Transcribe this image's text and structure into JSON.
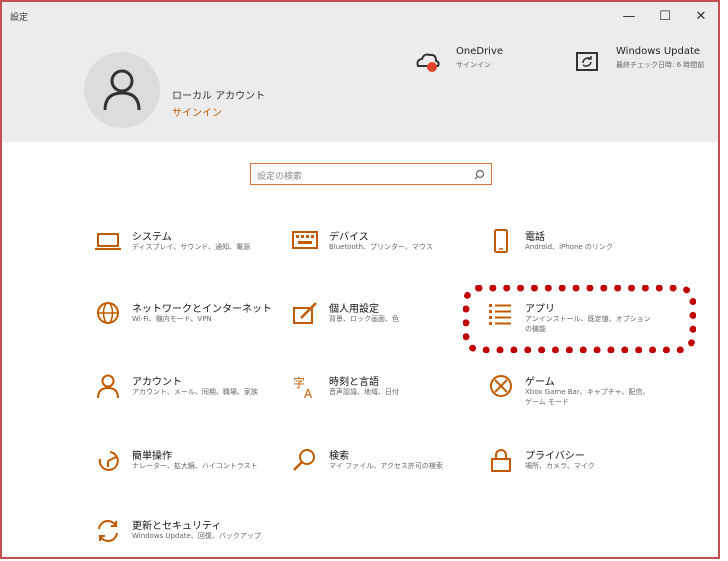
{
  "window": {
    "title": "設定",
    "minimize_glyph": "—",
    "maximize_glyph": "☐",
    "close_glyph": "✕"
  },
  "account": {
    "name": "ローカル アカウント",
    "signin": "サインイン"
  },
  "services": [
    {
      "title": "OneDrive",
      "sub": "サインイン",
      "icon": "cloud-icon"
    },
    {
      "title": "Windows Update",
      "sub": "最終チェック日時: 6 時間前",
      "icon": "update-icon"
    }
  ],
  "search": {
    "placeholder": "設定の検索"
  },
  "tiles": [
    {
      "title": "システム",
      "sub": "ディスプレイ、サウンド、通知、電源",
      "icon": "laptop-icon"
    },
    {
      "title": "デバイス",
      "sub": "Bluetooth、プリンター、マウス",
      "icon": "keyboard-icon"
    },
    {
      "title": "電話",
      "sub": "Android、iPhone のリンク",
      "icon": "phone-icon"
    },
    {
      "title": "ネットワークとインターネット",
      "sub": "Wi-Fi、機内モード、VPN",
      "icon": "globe-icon"
    },
    {
      "title": "個人用設定",
      "sub": "背景、ロック画面、色",
      "icon": "paint-icon"
    },
    {
      "title": "アプリ",
      "sub": "アンインストール、既定値、オプションの機能",
      "icon": "apps-list-icon"
    },
    {
      "title": "アカウント",
      "sub": "アカウント、メール、同期、職場、家族",
      "icon": "person-icon"
    },
    {
      "title": "時刻と言語",
      "sub": "音声認識、地域、日付",
      "icon": "language-icon"
    },
    {
      "title": "ゲーム",
      "sub": "Xbox Game Bar、キャプチャ、配信、ゲーム モード",
      "icon": "xbox-icon"
    },
    {
      "title": "簡単操作",
      "sub": "ナレーター、拡大鏡、ハイコントラスト",
      "icon": "accessibility-icon"
    },
    {
      "title": "検索",
      "sub": "マイ ファイル、アクセス許可の検索",
      "icon": "search-icon"
    },
    {
      "title": "プライバシー",
      "sub": "場所、カメラ、マイク",
      "icon": "lock-icon"
    },
    {
      "title": "更新とセキュリティ",
      "sub": "Windows Update、回復、バックアップ",
      "icon": "sync-icon"
    }
  ],
  "colors": {
    "accent": "#c25a00",
    "highlight": "#c00000",
    "frame": "#c0504d"
  }
}
